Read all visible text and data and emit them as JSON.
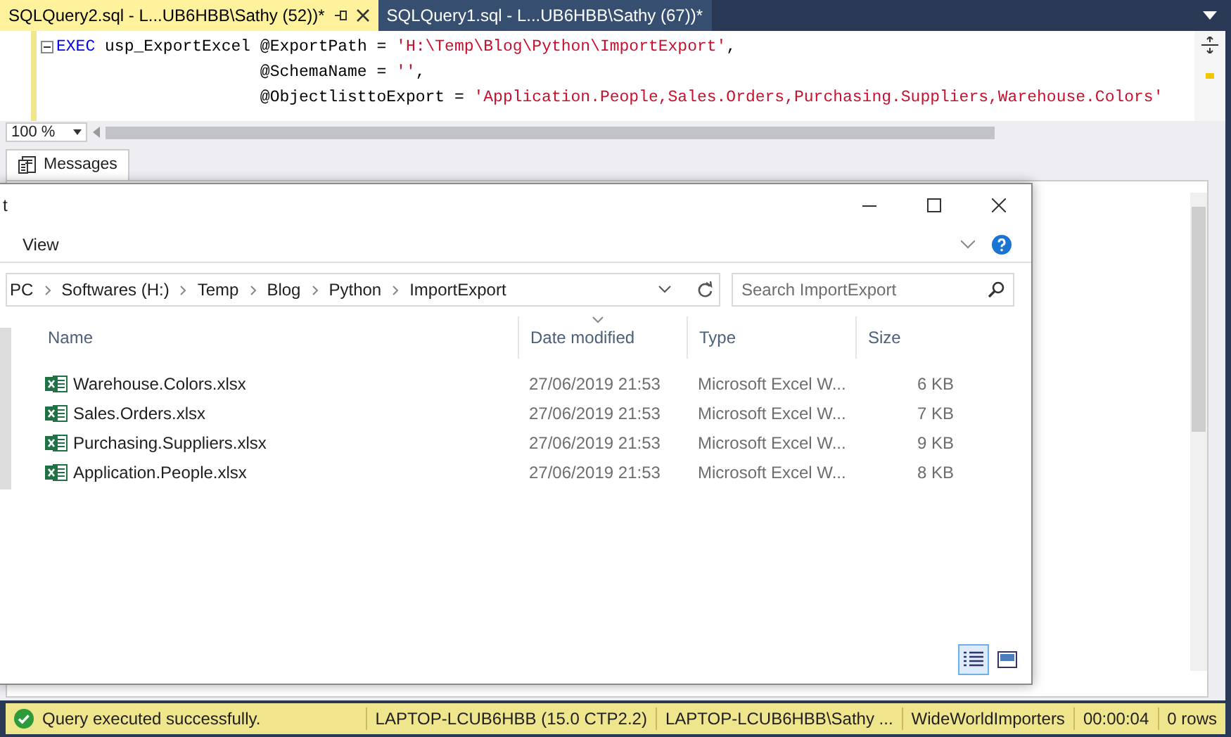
{
  "editor_tabs": [
    {
      "label": "SQLQuery2.sql - L...UB6HBB\\Sathy (52))*",
      "selected": true
    },
    {
      "label": "SQLQuery1.sql - L...UB6HBB\\Sathy (67))*",
      "selected": false
    }
  ],
  "code_lines": [
    {
      "indented": false,
      "segments": [
        {
          "kind": "keyword",
          "text": "EXEC"
        },
        {
          "kind": "plain",
          "text": " usp_ExportExcel @ExportPath = "
        },
        {
          "kind": "string",
          "text": "'H:\\Temp\\Blog\\Python\\ImportExport'"
        },
        {
          "kind": "plain",
          "text": ","
        }
      ]
    },
    {
      "indented": true,
      "segments": [
        {
          "kind": "plain",
          "text": "@SchemaName = "
        },
        {
          "kind": "string",
          "text": "''"
        },
        {
          "kind": "plain",
          "text": ","
        }
      ]
    },
    {
      "indented": true,
      "segments": [
        {
          "kind": "plain",
          "text": "@ObjectlisttoExport = "
        },
        {
          "kind": "string",
          "text": "'Application.People,Sales.Orders,Purchasing.Suppliers,Warehouse.Colors'"
        }
      ]
    }
  ],
  "zoom": "100 %",
  "results_tabs": [
    {
      "label": "Messages",
      "selected": true
    }
  ],
  "explorer": {
    "title": "t",
    "menu": [
      "View"
    ],
    "breadcrumb": [
      "PC",
      "Softwares (H:)",
      "Temp",
      "Blog",
      "Python",
      "ImportExport"
    ],
    "search": {
      "placeholder": "Search ImportExport"
    },
    "columns": [
      "Name",
      "Date modified",
      "Type",
      "Size"
    ],
    "rows": [
      {
        "name": "Warehouse.Colors.xlsx",
        "date": "27/06/2019 21:53",
        "type": "Microsoft Excel W...",
        "size": "6 KB"
      },
      {
        "name": "Sales.Orders.xlsx",
        "date": "27/06/2019 21:53",
        "type": "Microsoft Excel W...",
        "size": "7 KB"
      },
      {
        "name": "Purchasing.Suppliers.xlsx",
        "date": "27/06/2019 21:53",
        "type": "Microsoft Excel W...",
        "size": "9 KB"
      },
      {
        "name": "Application.People.xlsx",
        "date": "27/06/2019 21:53",
        "type": "Microsoft Excel W...",
        "size": "8 KB"
      }
    ]
  },
  "status_bar": {
    "message": "Query executed successfully.",
    "server": "LAPTOP-LCUB6HBB (15.0 CTP2.2)",
    "user": "LAPTOP-LCUB6HBB\\Sathy ...",
    "database": "WideWorldImporters",
    "elapsed": "00:00:04",
    "rows": "0 rows"
  }
}
